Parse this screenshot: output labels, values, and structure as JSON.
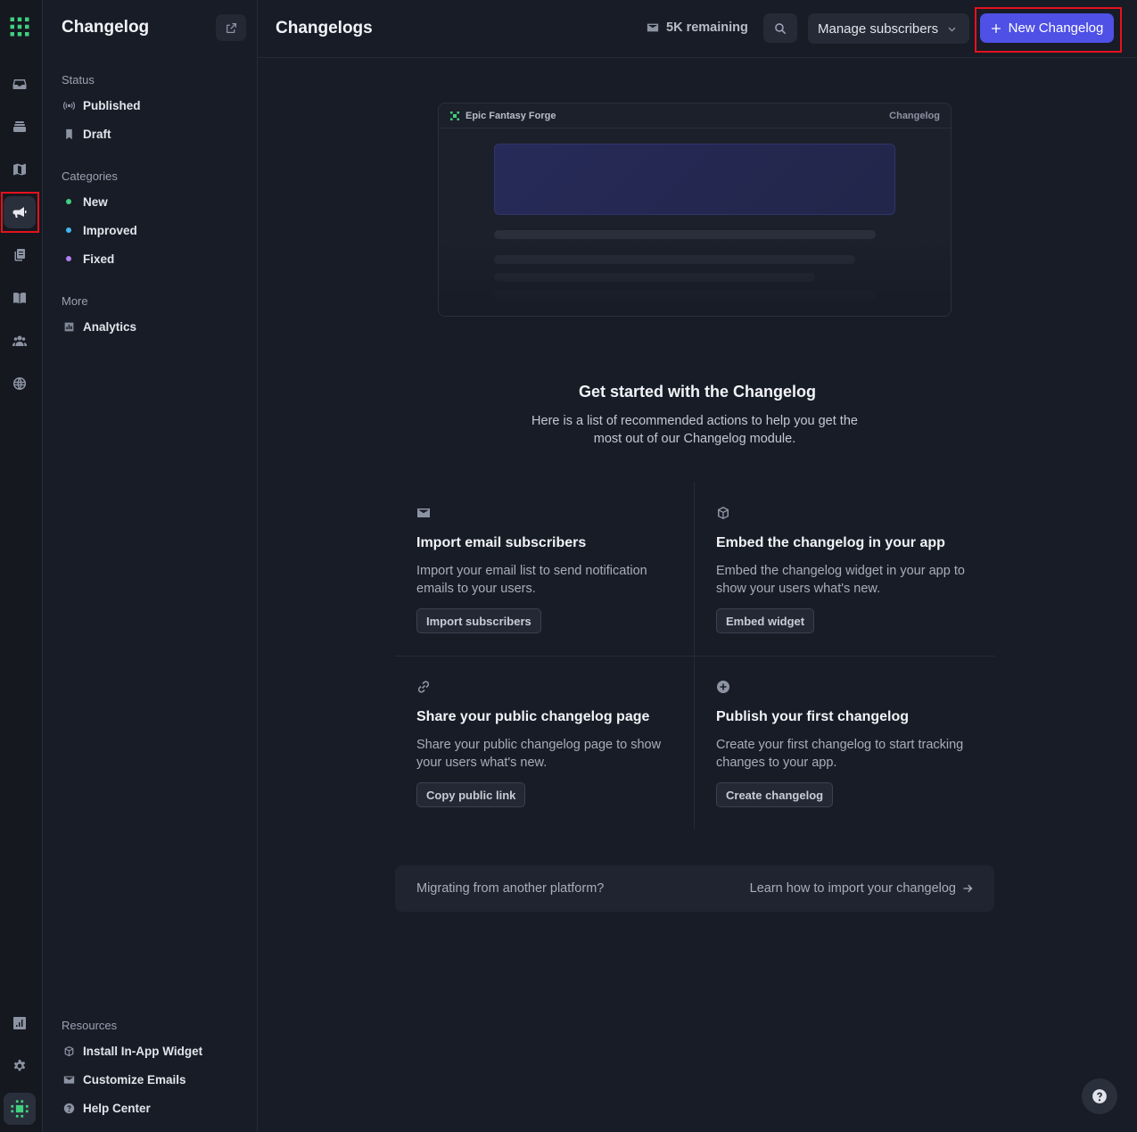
{
  "rail": {
    "items": [
      "inbox-icon",
      "roadmap-stack-icon",
      "map-icon",
      "megaphone-icon",
      "documents-icon",
      "book-icon",
      "users-icon",
      "globe-icon"
    ],
    "bottom": [
      "analytics-icon",
      "settings-icon",
      "workspace-icon"
    ]
  },
  "sidebar": {
    "title": "Changelog",
    "status_label": "Status",
    "status_items": [
      {
        "label": "Published",
        "icon": "broadcast-icon"
      },
      {
        "label": "Draft",
        "icon": "bookmark-icon"
      }
    ],
    "categories_label": "Categories",
    "categories": [
      {
        "label": "New",
        "color": "#3fd07f"
      },
      {
        "label": "Improved",
        "color": "#41b7f0"
      },
      {
        "label": "Fixed",
        "color": "#b07ef0"
      }
    ],
    "more_label": "More",
    "more_items": [
      {
        "label": "Analytics",
        "icon": "chart-icon"
      }
    ],
    "resources_label": "Resources",
    "resources": [
      {
        "label": "Install In-App Widget",
        "icon": "cube-icon"
      },
      {
        "label": "Customize Emails",
        "icon": "mail-icon"
      },
      {
        "label": "Help Center",
        "icon": "question-icon"
      }
    ]
  },
  "header": {
    "title": "Changelogs",
    "remaining": "5K remaining",
    "manage_label": "Manage subscribers",
    "new_label": "New Changelog"
  },
  "preview": {
    "brand": "Epic Fantasy Forge",
    "right_label": "Changelog"
  },
  "get_started": {
    "title": "Get started with the Changelog",
    "subtitle": "Here is a list of recommended actions to help you get the most out of our Changelog module."
  },
  "cards": [
    {
      "icon": "mail-icon",
      "title": "Import email subscribers",
      "desc": "Import your email list to send notification emails to your users.",
      "button": "Import subscribers"
    },
    {
      "icon": "cube-icon",
      "title": "Embed the changelog in your app",
      "desc": "Embed the changelog widget in your app to show your users what's new.",
      "button": "Embed widget"
    },
    {
      "icon": "link-icon",
      "title": "Share your public changelog page",
      "desc": "Share your public changelog page to show your users what's new.",
      "button": "Copy public link"
    },
    {
      "icon": "plus-circle-icon",
      "title": "Publish your first changelog",
      "desc": "Create your first changelog to start tracking changes to your app.",
      "button": "Create changelog"
    }
  ],
  "migrate": {
    "left": "Migrating from another platform?",
    "right": "Learn how to import your changelog"
  },
  "colors": {
    "accent": "#4e50e6",
    "brand_green": "#3fd07f",
    "highlight_red": "#e5121d"
  }
}
